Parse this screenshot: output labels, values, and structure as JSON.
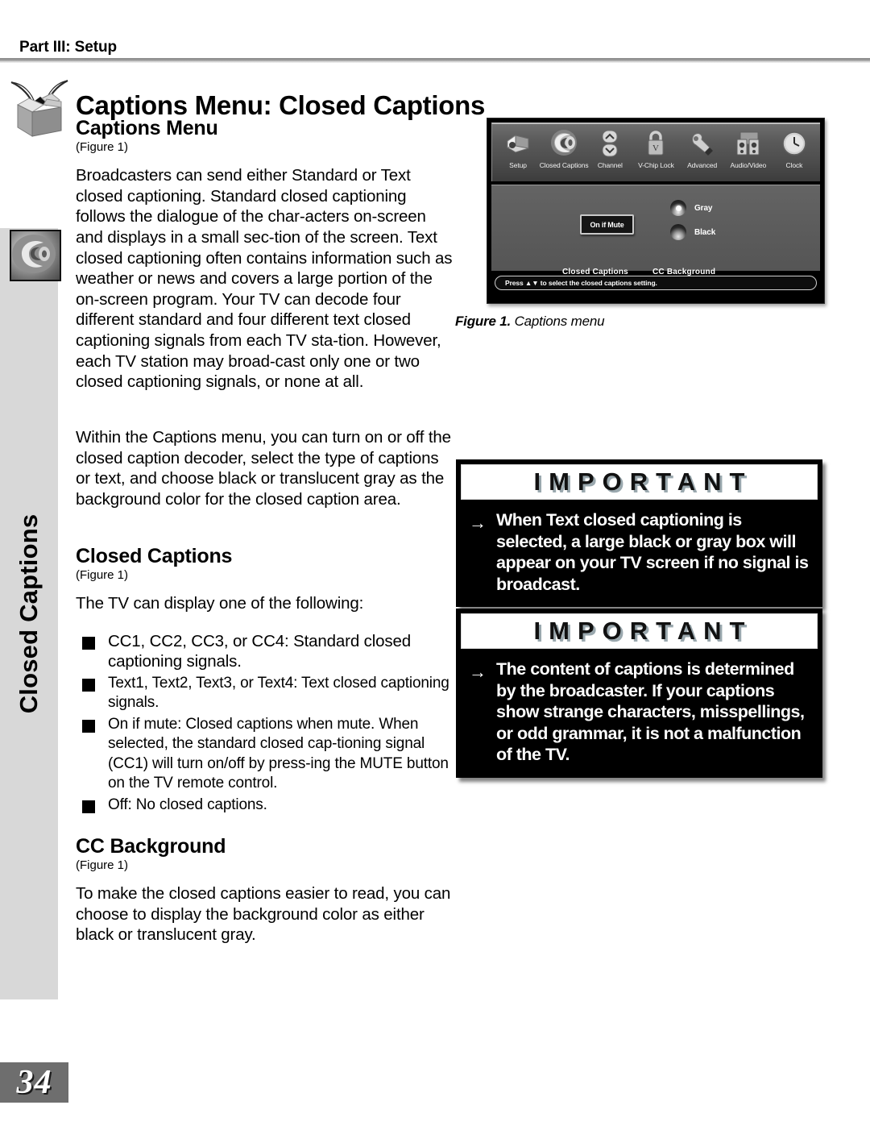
{
  "header": {
    "part_label": "Part III: Setup",
    "page_title": "Captions Menu: Closed Captions",
    "page_number": "34"
  },
  "side_tab": {
    "label": "Closed Captions",
    "icon": "closed-captions-ear-icon"
  },
  "left_column": {
    "section1": {
      "heading": "Captions Menu",
      "figure_ref": "(Figure 1)",
      "paragraphs": [
        "Broadcasters can send either Standard or Text closed captioning.  Standard closed captioning follows the dialogue of the char-acters on-screen and displays in a small sec-tion of the screen.  Text closed captioning often contains information such as weather or news and covers a large portion of the on-screen program.  Your TV can decode four different standard and four different text closed captioning signals from each TV sta-tion.  However, each TV station may broad-cast only one or two closed captioning signals, or none at all.",
        "Within the Captions menu, you can turn on or off the closed caption decoder, select the type of captions or text, and choose black or translucent gray as the background color for the  closed caption area."
      ]
    },
    "section2": {
      "heading": "Closed Captions",
      "figure_ref": "(Figure 1)",
      "intro": "The TV can display one of the following:",
      "bullets": [
        "CC1, CC2, CC3, or CC4: Standard closed captioning signals.",
        "Text1, Text2, Text3, or Text4: Text closed captioning signals.",
        "On if mute: Closed captions when mute. When selected, the standard closed cap-tioning signal (CC1) will turn on/off by press-ing the MUTE button on the TV remote control.",
        "Off: No closed captions."
      ]
    },
    "section3": {
      "heading": "CC Background",
      "figure_ref": "(Figure 1)",
      "paragraph": "To make the closed captions easier to read, you can choose to display the background color as either black or translucent gray."
    }
  },
  "figure": {
    "caption_bold": "Figure 1.",
    "caption_text": "Captions menu",
    "tv_menu": {
      "icon_items": [
        {
          "label": "Setup",
          "icon": "setup-camera-icon",
          "selected": false
        },
        {
          "label": "Closed Captions",
          "icon": "ear-icon",
          "selected": true
        },
        {
          "label": "Channel",
          "icon": "up-down-chevrons-icon",
          "selected": false
        },
        {
          "label": "V-Chip Lock",
          "icon": "padlock-icon",
          "selected": false
        },
        {
          "label": "Advanced",
          "icon": "wrench-icon",
          "selected": false
        },
        {
          "label": "Audio/Video",
          "icon": "speakers-icon",
          "selected": false
        },
        {
          "label": "Clock",
          "icon": "clock-icon",
          "selected": false
        }
      ],
      "setting_value": "On if Mute",
      "radio_options": [
        {
          "label": "Gray",
          "selected": true
        },
        {
          "label": "Black",
          "selected": false
        }
      ],
      "column_labels": [
        "Closed Captions",
        "CC Background"
      ],
      "hint": "Press ▲▼ to select the closed captions setting."
    }
  },
  "important_boxes": [
    {
      "title": "IMPORTANT",
      "arrow": "→",
      "text": "When Text closed captioning is selected, a large black or gray box will appear on your TV screen if no signal is broadcast."
    },
    {
      "title": "IMPORTANT",
      "arrow": "→",
      "text": "The content of captions is determined by the broadcaster.  If your captions show strange characters, misspellings, or odd grammar, it is not a malfunction of the TV."
    }
  ],
  "colors": {
    "side_tab_bg": "#d8d8d8",
    "page_number_bg": "#6e6e6e",
    "rule": "#9b9b9b",
    "important_bg": "#000000"
  }
}
